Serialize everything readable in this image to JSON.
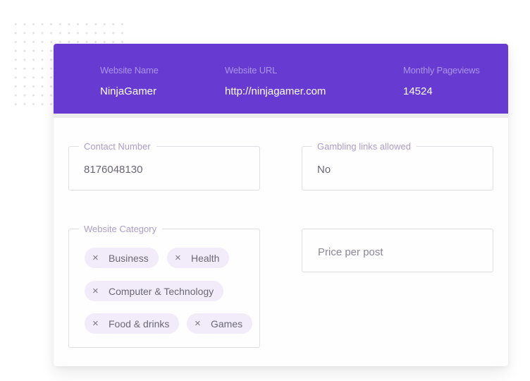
{
  "header": {
    "columns": [
      {
        "label": "Website Name",
        "value": "NinjaGamer"
      },
      {
        "label": "Website URL",
        "value": "http://ninjagamer.com"
      },
      {
        "label": "Monthly Pageviews",
        "value": "14524"
      }
    ]
  },
  "form": {
    "contact_number": {
      "label": "Contact Number",
      "value": "8176048130"
    },
    "gambling_links": {
      "label": "Gambling links allowed",
      "value": "No"
    },
    "website_category": {
      "label": "Website Category",
      "remove_icon": "×",
      "chips": [
        "Business",
        "Health",
        "Computer & Technology",
        "Food & drinks",
        "Games"
      ]
    },
    "price_per_post": {
      "placeholder": "Price per post",
      "value": ""
    }
  },
  "colors": {
    "header_bg": "#673bd1",
    "chip_bg": "#f1ebfa",
    "label_color": "#ab9dc9"
  }
}
